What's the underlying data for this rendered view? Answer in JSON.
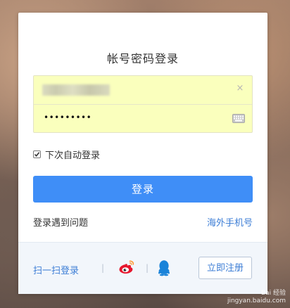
{
  "login_card": {
    "title": "帐号密码登录",
    "username_field": {
      "value_obscured": true,
      "clear_icon": "×"
    },
    "password_field": {
      "masked_value": "•••••••••",
      "keyboard_icon_name": "keyboard-icon"
    },
    "remember_label": "下次自动登录",
    "remember_checked": true,
    "login_button_label": "登录",
    "problem_link": "登录遇到问题",
    "overseas_link": "海外手机号"
  },
  "footer": {
    "scan_login": "扫一扫登录",
    "separator": "|",
    "social_icons": [
      "weibo-icon",
      "qq-icon"
    ],
    "register_button_label": "立即注册"
  },
  "watermark": {
    "brand": "Bai 经验",
    "site": "jingyan.baidu.com"
  },
  "colors": {
    "primary_button": "#3f8ef7",
    "link": "#3d7ed6",
    "autofill_bg": "#faffbd",
    "footer_bg": "#f2f6fb"
  }
}
